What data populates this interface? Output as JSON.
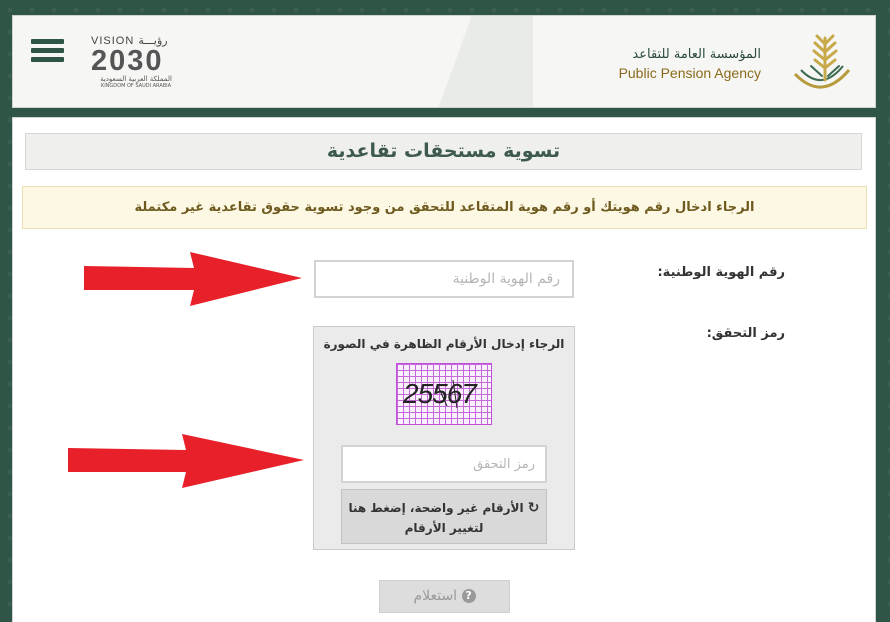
{
  "header": {
    "vision": {
      "top": "VISION",
      "top_ar": "رؤيـــة",
      "year": "2030",
      "sub_ar": "المملكة العربية السعودية",
      "sub_en": "KINGDOM OF SAUDI ARABIA"
    },
    "agency": {
      "name_ar": "المؤسسة العامة للتقاعد",
      "name_en": "Public Pension Agency"
    }
  },
  "main": {
    "title": "تسوية مستحقات تقاعدية",
    "notice": "الرجاء ادخال رقم هويتك أو رقم هوية المتقاعد للتحقق من وجود تسوية حقوق تقاعدية غير مكتملة",
    "id_label": "رقم الهوية الوطنية:",
    "id_placeholder": "رقم الهوية الوطنية",
    "captcha_label": "رمز التحقق:",
    "captcha_hint": "الرجاء إدخال الأرقام الظاهرة في الصورة",
    "captcha_text": "25567",
    "captcha_placeholder": "رمز التحقق",
    "refresh_line1": "الأرقام غير واضحة، إضغط هنا",
    "refresh_line2": "لتغيير الأرقام",
    "submit_label": "استعلام"
  },
  "colors": {
    "background": "#2f5546",
    "arrow": "#e8202a",
    "captcha_grid": "#c76ad9"
  }
}
